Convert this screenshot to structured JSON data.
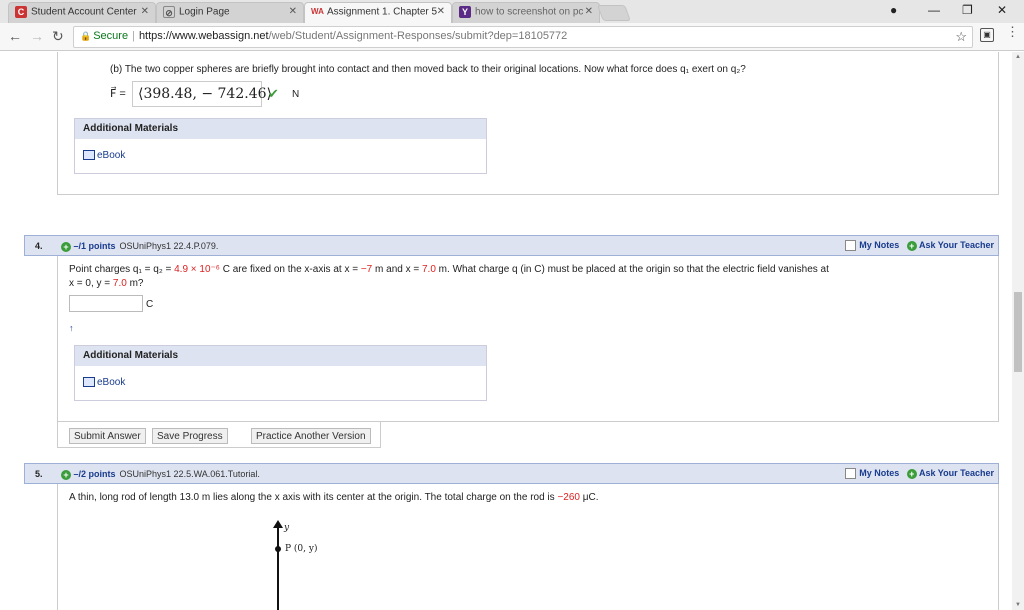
{
  "browser": {
    "tabs": [
      {
        "title": "Student Account Center",
        "favicon": "C"
      },
      {
        "title": "Login Page",
        "favicon": "⊘"
      },
      {
        "title": "Assignment 1. Chapter 5",
        "favicon": "WA"
      },
      {
        "title": "how to screenshot on pc",
        "favicon": "Y"
      }
    ],
    "secure_label": "Secure",
    "url_domain": "https://www.webassign.net",
    "url_path": "/web/Student/Assignment-Responses/submit?dep=18105772"
  },
  "q3": {
    "part_b_text": "(b) The two copper spheres are briefly brought into contact and then moved back to their original locations. Now what force does q₁ exert on q₂?",
    "answer_prefix": "F⃗ =",
    "answer_value": "⟨398.48, − 742.46⟩",
    "answer_check": "✔",
    "answer_unit": "N",
    "additional_materials_label": "Additional Materials",
    "ebook_label": "eBook"
  },
  "q4": {
    "number": "4.",
    "points": "–/1 points",
    "source": "OSUniPhys1 22.4.P.079.",
    "my_notes": "My Notes",
    "ask_teacher": "Ask Your Teacher",
    "text_a": "Point charges q₁ = q₂ = ",
    "charge_value": "4.9 × 10⁻⁶",
    "text_b": " C are fixed on the x-axis at x = ",
    "x1": "−7",
    "text_c": " m and x = ",
    "x2": "7.0",
    "text_d": " m. What charge q (in C) must be placed at the origin so that the electric field vanishes at",
    "text_e": "x = 0, y = ",
    "y_value": "7.0",
    "text_f": " m?",
    "answer_unit": "C",
    "additional_materials_label": "Additional Materials",
    "ebook_label": "eBook",
    "submit_button": "Submit Answer",
    "save_button": "Save Progress",
    "practice_button": "Practice Another Version"
  },
  "q5": {
    "number": "5.",
    "points": "–/2 points",
    "source": "OSUniPhys1 22.5.WA.061.Tutorial.",
    "my_notes": "My Notes",
    "ask_teacher": "Ask Your Teacher",
    "text_a": "A thin, long rod of length 13.0 m lies along the x axis with its center at the origin. The total charge on the rod is ",
    "charge_value": "−260",
    "text_b": " μC.",
    "figure_axis_label": "y",
    "figure_point_label": "P (0, y)"
  }
}
